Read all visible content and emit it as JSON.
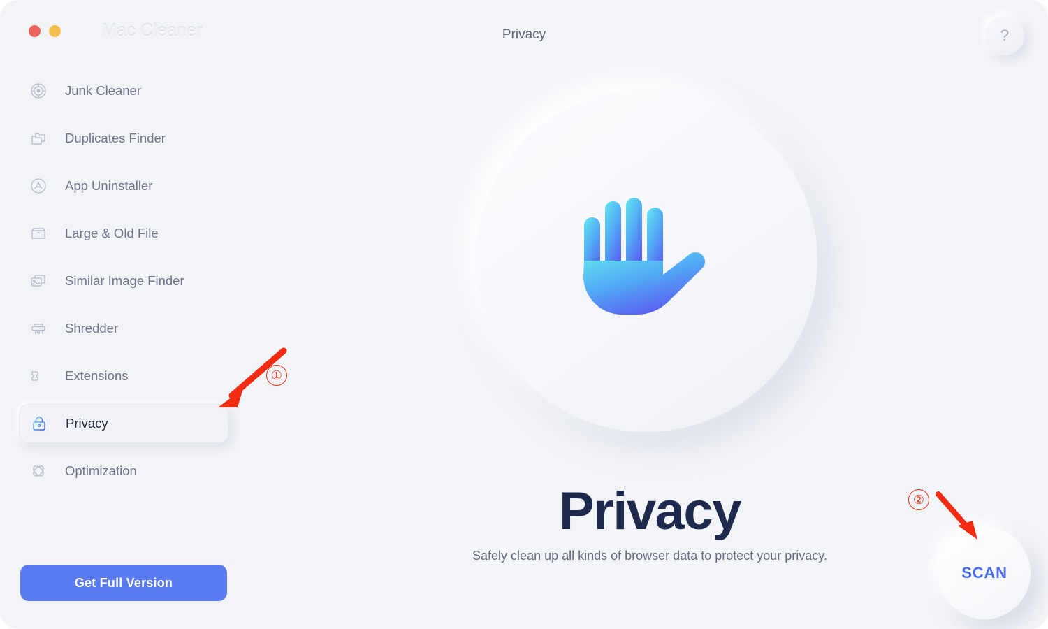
{
  "window": {
    "app_name": "Mac Cleaner",
    "traffic_lights": [
      {
        "name": "close",
        "color": "#e9635a"
      },
      {
        "name": "minimize",
        "color": "#f3bf4c"
      }
    ]
  },
  "header": {
    "title": "Privacy",
    "help_label": "?"
  },
  "sidebar": {
    "items": [
      {
        "label": "Junk Cleaner",
        "icon": "target-icon",
        "active": false
      },
      {
        "label": "Duplicates Finder",
        "icon": "folders-icon",
        "active": false
      },
      {
        "label": "App Uninstaller",
        "icon": "app-store-icon",
        "active": false
      },
      {
        "label": "Large & Old File",
        "icon": "box-icon",
        "active": false
      },
      {
        "label": "Similar Image Finder",
        "icon": "images-icon",
        "active": false
      },
      {
        "label": "Shredder",
        "icon": "shredder-icon",
        "active": false
      },
      {
        "label": "Extensions",
        "icon": "puzzle-piece-icon",
        "active": false
      },
      {
        "label": "Privacy",
        "icon": "lock-icon",
        "active": true
      },
      {
        "label": "Optimization",
        "icon": "atom-icon",
        "active": false
      }
    ],
    "cta_label": "Get Full Version"
  },
  "main": {
    "illustration": "stop-hand-icon",
    "heading": "Privacy",
    "subheading": "Safely clean up all kinds of browser data to protect your privacy.",
    "scan_label": "SCAN"
  },
  "annotations": [
    {
      "number": "①",
      "points_to": "sidebar-item-privacy"
    },
    {
      "number": "②",
      "points_to": "scan-button"
    }
  ],
  "colors": {
    "window_bg": "#f3f4f8",
    "accent_blue": "#5a7bef",
    "scan_text": "#4a6cf0",
    "heading_navy": "#1d2a4d",
    "label_gray": "#6f748a",
    "annotation_red": "#f22c12"
  }
}
